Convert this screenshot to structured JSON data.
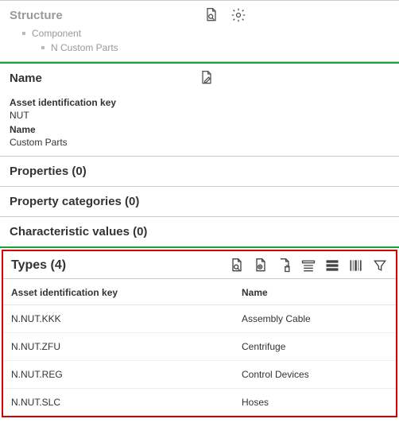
{
  "structure": {
    "title": "Structure",
    "tree": {
      "lvl1": "Component",
      "lvl2": "N Custom Parts"
    }
  },
  "name_section": {
    "title": "Name",
    "fields": [
      {
        "label": "Asset identification key",
        "value": "NUT"
      },
      {
        "label": "Name",
        "value": "Custom Parts"
      }
    ]
  },
  "properties": {
    "title": "Properties (0)"
  },
  "property_categories": {
    "title": "Property categories (0)"
  },
  "characteristic_values": {
    "title": "Characteristic values (0)"
  },
  "types": {
    "title": "Types (4)",
    "columns": {
      "key": "Asset identification key",
      "name": "Name"
    },
    "rows": [
      {
        "key": "N.NUT.KKK",
        "name": "Assembly Cable"
      },
      {
        "key": "N.NUT.ZFU",
        "name": "Centrifuge"
      },
      {
        "key": "N.NUT.REG",
        "name": "Control Devices"
      },
      {
        "key": "N.NUT.SLC",
        "name": "Hoses"
      }
    ]
  }
}
